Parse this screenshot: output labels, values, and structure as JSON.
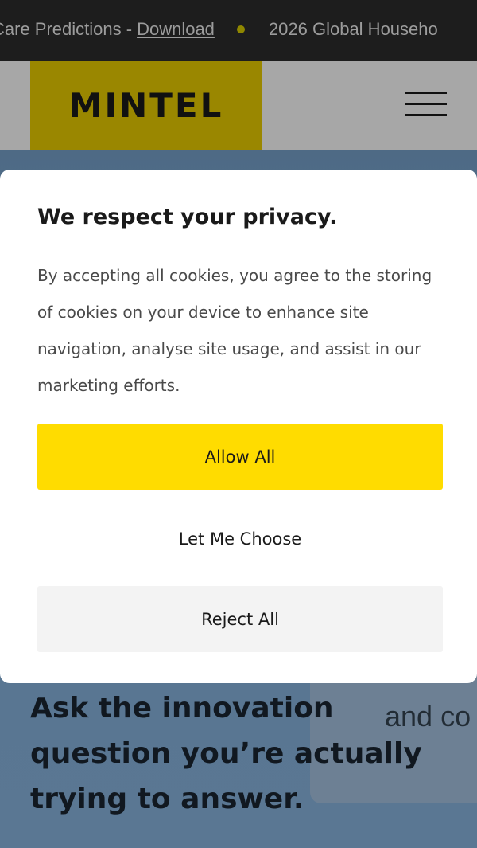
{
  "ticker": {
    "text": "Care Predictions -",
    "link": "Download",
    "next_text": "2026 Global Househo"
  },
  "header": {
    "logo": "MINTEL"
  },
  "hero": {
    "heading": "Ask the innovation question you’re actually trying to answer.",
    "card_text": "and co"
  },
  "cookie_modal": {
    "title": "We respect your privacy.",
    "body": "By accepting all cookies, you agree to the storing of cookies on your device to enhance site navigation, analyse site usage, and assist in our marketing efforts.",
    "allow_label": "Allow All",
    "choose_label": "Let Me Choose",
    "reject_label": "Reject All"
  },
  "colors": {
    "accent": "#ffdc00",
    "ticker_bg": "#1d1d1d"
  }
}
